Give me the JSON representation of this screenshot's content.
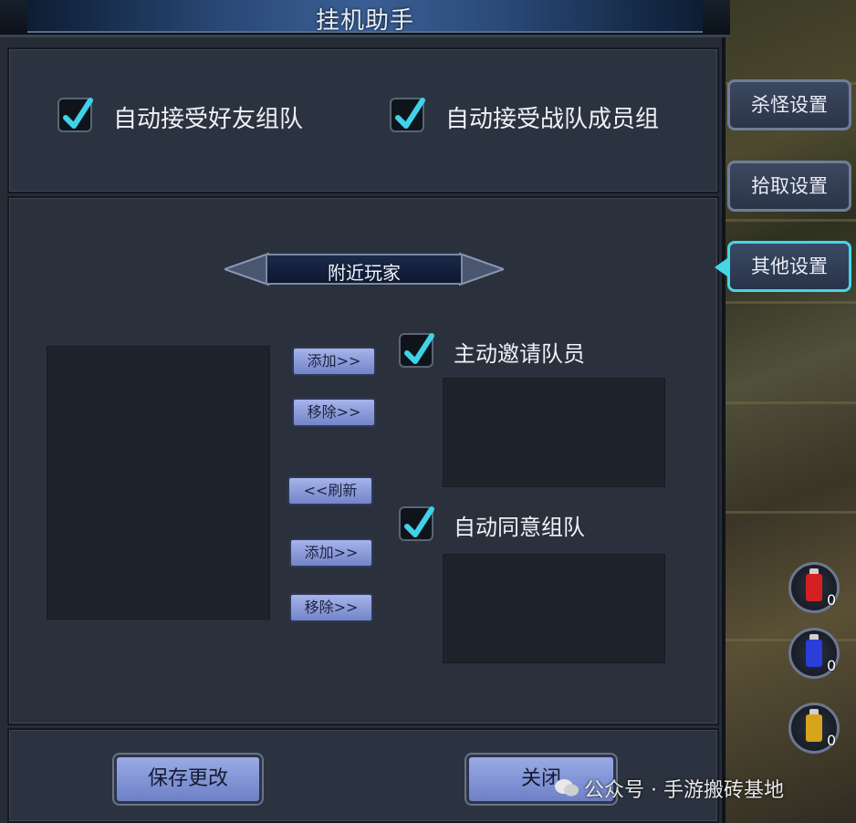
{
  "window": {
    "title": "挂机助手"
  },
  "top_options": [
    {
      "label": "自动接受好友组队",
      "checked": true
    },
    {
      "label": "自动接受战队成员组",
      "checked": true
    }
  ],
  "nearby": {
    "header": "附近玩家"
  },
  "buttons": {
    "add_1": "添加>>",
    "remove_1": "移除>>",
    "refresh": "<<刷新",
    "add_2": "添加>>",
    "remove_2": "移除>>"
  },
  "right_options": [
    {
      "label": "主动邀请队员",
      "checked": true
    },
    {
      "label": "自动同意组队",
      "checked": true
    }
  ],
  "footer": {
    "save": "保存更改",
    "close": "关闭"
  },
  "side_tabs": [
    {
      "label": "杀怪设置",
      "active": false
    },
    {
      "label": "拾取设置",
      "active": false
    },
    {
      "label": "其他设置",
      "active": true
    }
  ],
  "potions": [
    {
      "icon": "red-potion-icon",
      "count": "0",
      "color": "#d42020"
    },
    {
      "icon": "blue-potion-icon",
      "count": "0",
      "color": "#2a3ed8"
    },
    {
      "icon": "yellow-potion-icon",
      "count": "0",
      "color": "#d8a41c"
    }
  ],
  "watermark": "公众号 · 手游搬砖基地",
  "colors": {
    "accent": "#45d6e6",
    "check": "#3fd2e8",
    "button": "#8a9ad8"
  }
}
